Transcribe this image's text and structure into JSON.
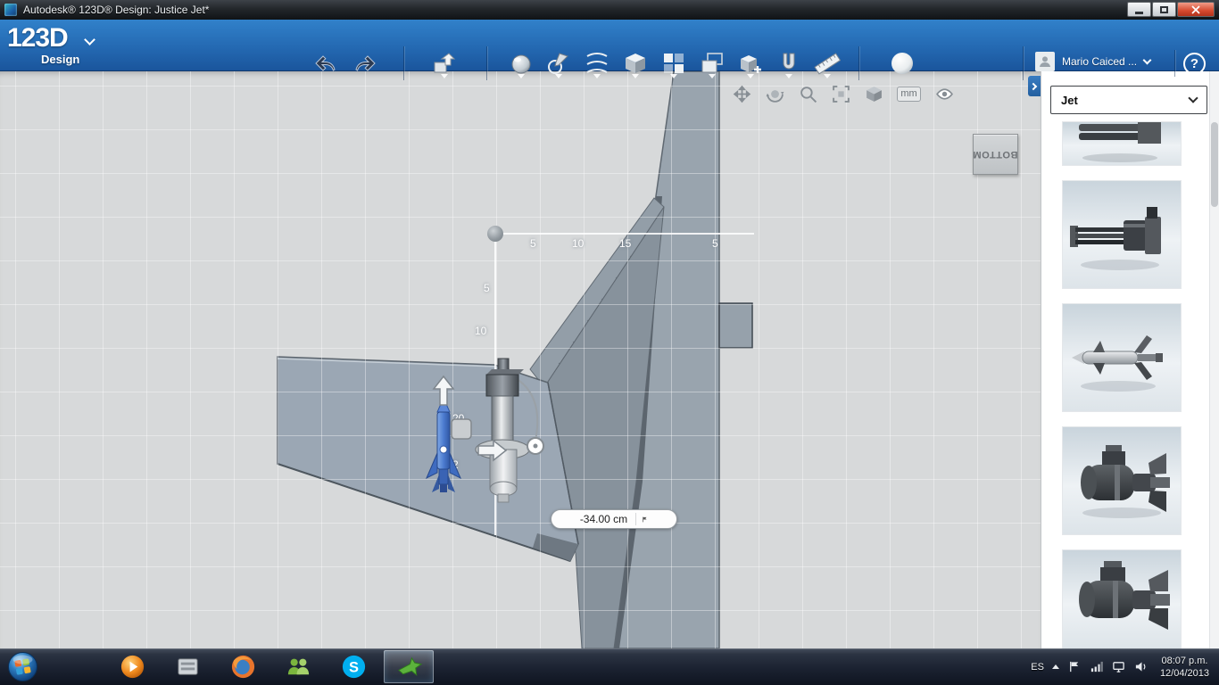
{
  "window": {
    "title": "Autodesk® 123D® Design: Justice Jet*"
  },
  "ribbon": {
    "logo_main": "123D",
    "logo_sub": "Design",
    "user_name": "Mario Caiced ...",
    "help_label": "?",
    "tools": [
      "undo",
      "redo",
      "transform",
      "primitives",
      "sketch",
      "construct",
      "modify",
      "pattern",
      "grouping",
      "combine",
      "snap",
      "measure",
      "material"
    ]
  },
  "canvas": {
    "view_cube_label": "BOTTOM",
    "units_label": "mm",
    "dimension_value": "-34.00 cm",
    "ruler_h": [
      "5",
      "10",
      "15",
      "5"
    ],
    "ruler_v": [
      "5",
      "10",
      "20",
      "2"
    ],
    "nav_icons": [
      "pan",
      "orbit",
      "zoom",
      "fit",
      "view-cube",
      "units",
      "visibility"
    ]
  },
  "panel": {
    "kit_selected": "Jet",
    "parts": [
      {
        "icon": "gun-bottom-partial-thumbnail"
      },
      {
        "icon": "gatling-gun-thumbnail"
      },
      {
        "icon": "missile-thumbnail"
      },
      {
        "icon": "bomb-thumbnail"
      },
      {
        "icon": "bomb-thumbnail"
      }
    ]
  },
  "taskbar": {
    "language_indicator": "ES",
    "skype_glyph": "S",
    "clock_time": "08:07 p.m.",
    "clock_date": "12/04/2013",
    "apps": [
      "start",
      "explorer",
      "media-player",
      "library",
      "firefox",
      "messenger",
      "skype",
      "123d-design"
    ]
  }
}
